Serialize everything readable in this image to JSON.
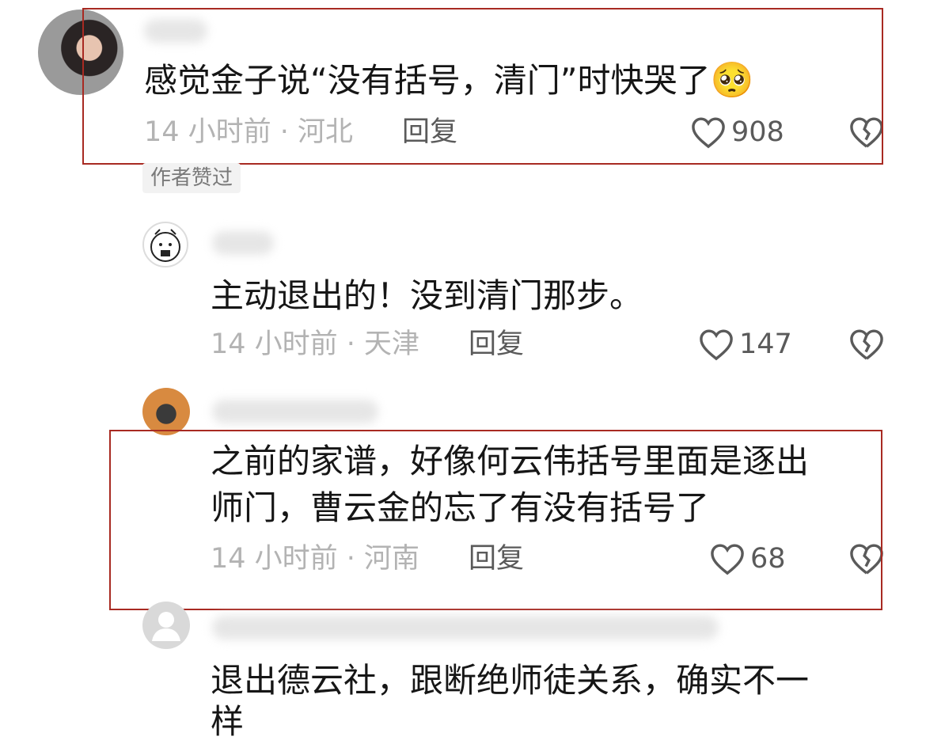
{
  "comments": [
    {
      "text": "感觉金子说“没有括号，清门”时快哭了",
      "emoji": "🥺",
      "meta": "14 小时前 · 河北",
      "reply": "回复",
      "likes": "908",
      "badge": "作者赞过"
    },
    {
      "text": "主动退出的！没到清门那步。",
      "meta": "14 小时前 · 天津",
      "reply": "回复",
      "likes": "147"
    },
    {
      "text_line1": "之前的家谱，好像何云伟括号里面是逐出",
      "text_line2": "师门，曹云金的忘了有没有括号了",
      "meta": "14 小时前 · 河南",
      "reply": "回复",
      "likes": "68"
    },
    {
      "text_line1": "退出德云社，跟断绝师徒关系，确实不一",
      "text_line2": "样"
    }
  ],
  "icons": {
    "like": "heart-outline-icon",
    "dislike": "broken-heart-outline-icon"
  },
  "colors": {
    "highlight_box": "#a82a22",
    "meta_text": "#b3b3b3",
    "action_text": "#5a5a5a"
  }
}
